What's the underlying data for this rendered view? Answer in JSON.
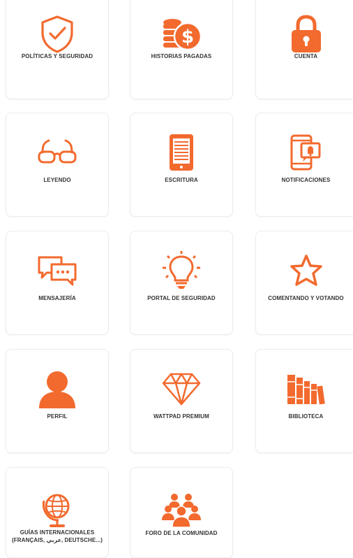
{
  "accent_color": "#f26a2e",
  "cards": [
    {
      "label": "POLÍTICAS Y SEGURIDAD",
      "icon": "shield-check-icon"
    },
    {
      "label": "HISTORIAS PAGADAS",
      "icon": "coins-dollar-icon"
    },
    {
      "label": "CUENTA",
      "icon": "lock-icon"
    },
    {
      "label": "LEYENDO",
      "icon": "glasses-icon"
    },
    {
      "label": "ESCRITURA",
      "icon": "tablet-writing-icon"
    },
    {
      "label": "NOTIFICACIONES",
      "icon": "phone-notification-icon"
    },
    {
      "label": "MENSAJERÍA",
      "icon": "chat-bubbles-icon"
    },
    {
      "label": "PORTAL DE SEGURIDAD",
      "icon": "lightbulb-icon"
    },
    {
      "label": "COMENTANDO Y VOTANDO",
      "icon": "star-icon"
    },
    {
      "label": "PERFIL",
      "icon": "user-icon"
    },
    {
      "label": "WATTPAD PREMIUM",
      "icon": "diamond-icon"
    },
    {
      "label": "BIBLIOTECA",
      "icon": "books-icon"
    },
    {
      "label": "GUÍAS INTERNACIONALES",
      "label2": "(FRANÇAIS, عربي, DEUTSCHE...)",
      "icon": "globe-icon"
    },
    {
      "label": "FORO DE LA COMUNIDAD",
      "icon": "community-group-icon"
    }
  ]
}
